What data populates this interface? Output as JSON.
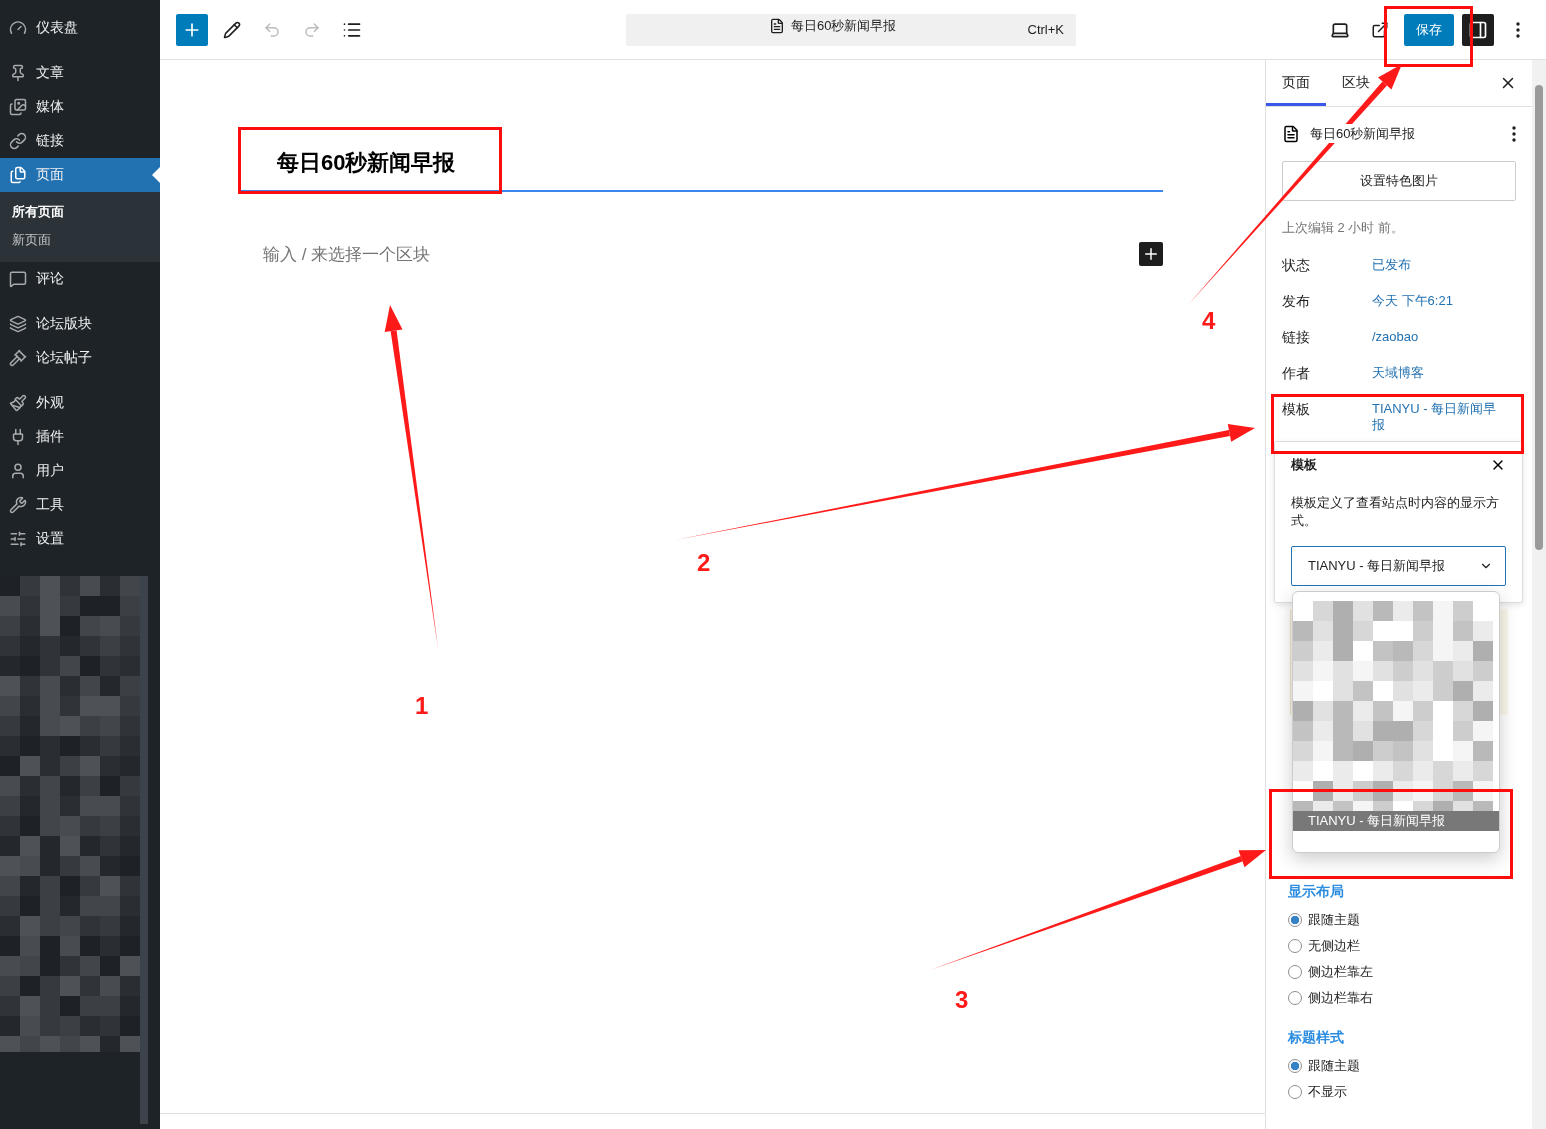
{
  "sidebar": {
    "groups": [
      {
        "items": [
          {
            "label": "仪表盘",
            "selected": false
          }
        ]
      },
      {
        "items": [
          {
            "label": "文章",
            "selected": false
          },
          {
            "label": "媒体",
            "selected": false
          },
          {
            "label": "链接",
            "selected": false
          },
          {
            "label": "页面",
            "selected": true,
            "children": [
              {
                "label": "所有页面",
                "selected": true
              },
              {
                "label": "新页面",
                "selected": false
              }
            ]
          },
          {
            "label": "评论",
            "selected": false
          }
        ]
      },
      {
        "items": [
          {
            "label": "论坛版块",
            "selected": false
          },
          {
            "label": "论坛帖子",
            "selected": false
          }
        ]
      },
      {
        "items": [
          {
            "label": "外观",
            "selected": false
          },
          {
            "label": "插件",
            "selected": false
          },
          {
            "label": "用户",
            "selected": false
          },
          {
            "label": "工具",
            "selected": false
          },
          {
            "label": "设置",
            "selected": false
          }
        ]
      }
    ]
  },
  "toolbar": {
    "undo_disabled": true,
    "redo_disabled": true,
    "document_title": "每日60秒新闻早报",
    "shortcut": "Ctrl+K",
    "save": "保存"
  },
  "editor": {
    "title": "每日60秒新闻早报",
    "placeholder": "输入 / 来选择一个区块"
  },
  "settings_panel": {
    "tabs": [
      {
        "label": "页面",
        "selected": true
      },
      {
        "label": "区块",
        "selected": false
      }
    ],
    "page_title": "每日60秒新闻早报",
    "featured_image_button": "设置特色图片",
    "last_edited": "上次编辑 2 小时 前。",
    "fields": [
      {
        "label": "状态",
        "value": "已发布"
      },
      {
        "label": "发布",
        "value": "今天 下午6:21"
      },
      {
        "label": "链接",
        "value": "/zaobao"
      },
      {
        "label": "作者",
        "value": "天域博客"
      },
      {
        "label": "模板",
        "value": "TIANYU - 每日新闻早报"
      }
    ],
    "template_popover": {
      "title": "模板",
      "description": "模板定义了查看站点时内容的显示方式。",
      "selected_value": "TIANYU - 每日新闻早报",
      "highlighted_option": "TIANYU - 每日新闻早报"
    },
    "option_groups": [
      {
        "title": "显示布局",
        "options": [
          {
            "label": "跟随主题",
            "selected": true
          },
          {
            "label": "无侧边栏",
            "selected": false
          },
          {
            "label": "侧边栏靠左",
            "selected": false
          },
          {
            "label": "侧边栏靠右",
            "selected": false
          }
        ]
      },
      {
        "title": "标题样式",
        "options": [
          {
            "label": "跟随主题",
            "selected": true
          },
          {
            "label": "不显示",
            "selected": false
          }
        ]
      }
    ]
  },
  "annotations": [
    {
      "label": "1"
    },
    {
      "label": "2"
    },
    {
      "label": "3"
    },
    {
      "label": "4"
    }
  ]
}
